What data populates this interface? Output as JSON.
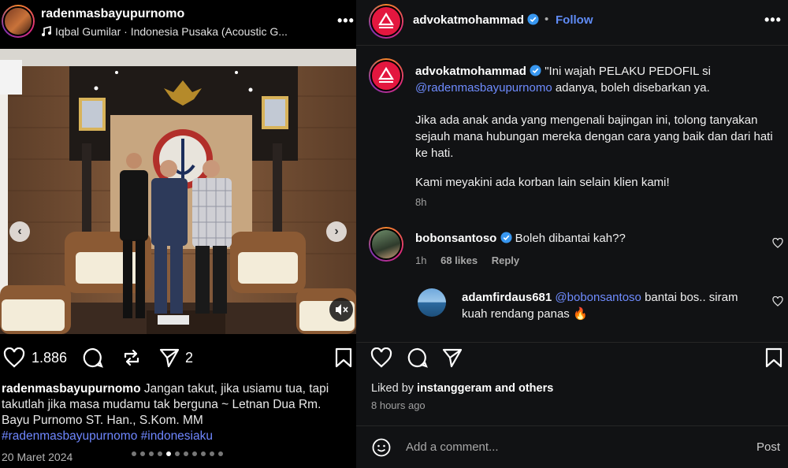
{
  "left_post": {
    "username": "radenmasbayupurnomo",
    "music": "Iqbal Gumilar · Indonesia Pusaka (Acoustic G...",
    "likes": "1.886",
    "shares": "2",
    "caption_user": "radenmasbayupurnomo",
    "caption_text": "Jangan takut, jika usiamu tua, tapi takutlah jika masa mudamu tak berguna ~ Letnan Dua Rm. Bayu Purnomo ST. Han., S.Kom. MM",
    "hashtags": "#radenmasbayupurnomo #indonesiaku",
    "date": "20 Maret 2024",
    "carousel_total": 11,
    "carousel_active": 4
  },
  "right_post": {
    "username": "advokatmohammad",
    "follow_label": "Follow",
    "bullet": "•",
    "caption_user": "advokatmohammad",
    "caption_p1_a": "\"Ini wajah PELAKU PEDOFIL si",
    "caption_p1_mention": "@radenmasbayupurnomo",
    "caption_p1_b": "adanya, boleh disebarkan ya.",
    "caption_p2": "Jika ada anak anda yang mengenali bajingan ini, tolong tanyakan sejauh mana hubungan mereka dengan cara yang baik dan dari hati ke hati.",
    "caption_p3": "Kami meyakini ada korban lain selain klien kami!",
    "caption_time": "8h",
    "comments": [
      {
        "user": "bobonsantoso",
        "text": "Boleh dibantai kah??",
        "time": "1h",
        "likes": "68 likes",
        "reply": "Reply"
      },
      {
        "user": "adamfirdaus681",
        "mention": "@bobonsantoso",
        "text": "bantai bos.. siram kuah rendang panas 🔥"
      }
    ],
    "liked_by_prefix": "Liked by",
    "liked_by_user": "instanggeram",
    "liked_by_suffix": "and others",
    "post_time": "8 hours ago",
    "add_comment_placeholder": "Add a comment...",
    "post_label": "Post"
  },
  "colors": {
    "accent_blue": "#5f8bf5",
    "mention": "#6f8cff",
    "brand_red": "#e3173f",
    "verified": "#3897f0"
  }
}
